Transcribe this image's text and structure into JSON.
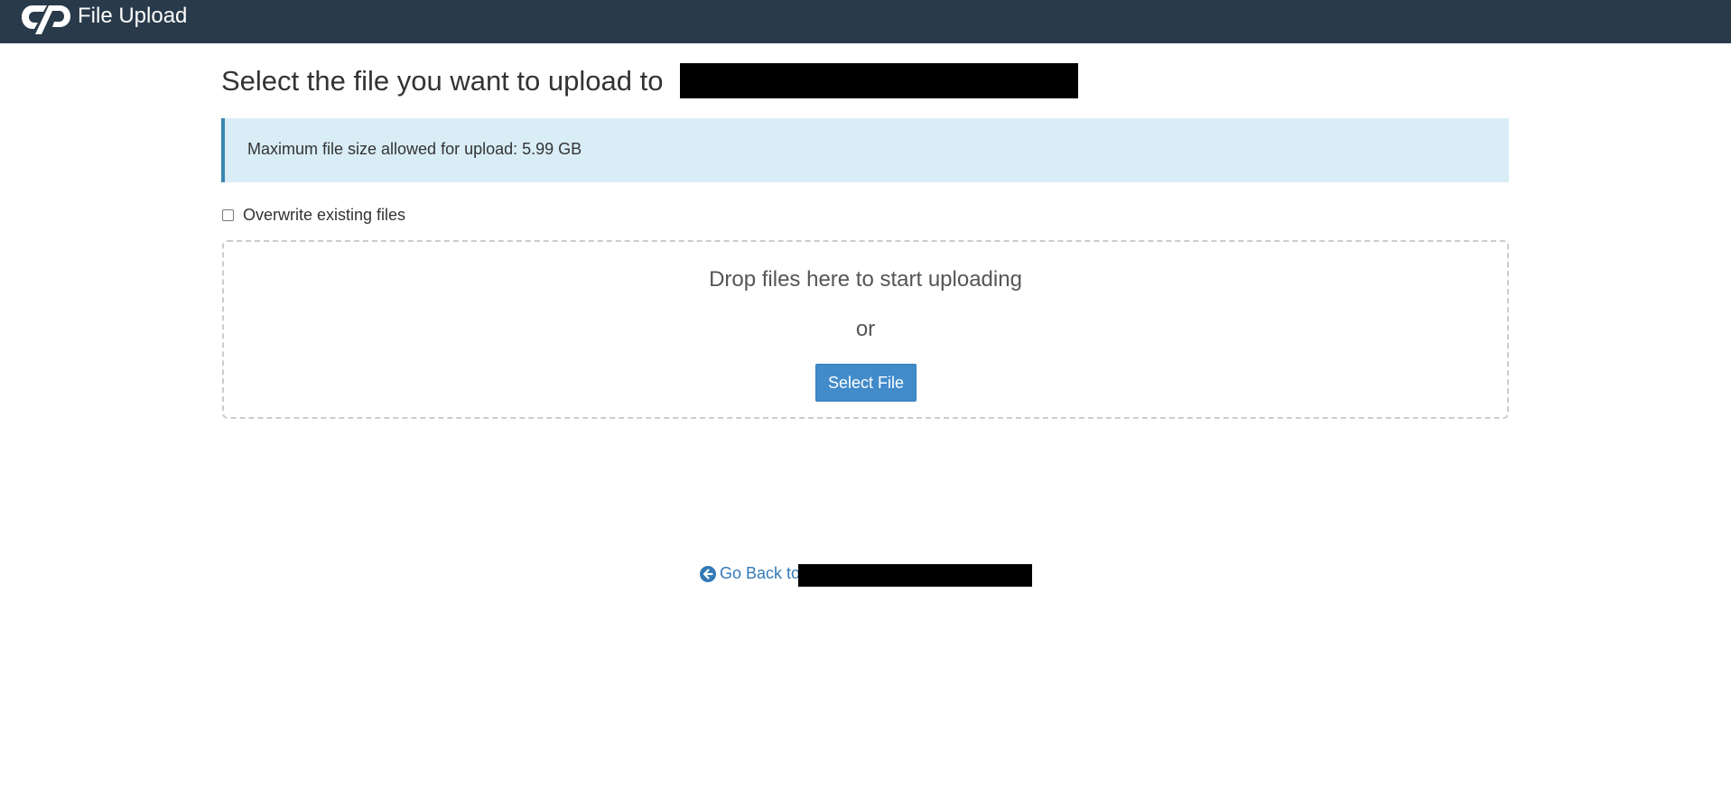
{
  "header": {
    "logo_icon": "cpanel-logo-icon",
    "app_title": "File Upload",
    "background_color": "#293a4a"
  },
  "main": {
    "title": "Select the file you want to upload to",
    "info": {
      "text": "Maximum file size allowed for upload: 5.99 GB",
      "background_color": "#d9edf7",
      "border_color": "#3a87ad"
    },
    "overwrite": {
      "label": "Overwrite existing files",
      "checked": false
    },
    "dropzone": {
      "drop_text": "Drop files here to start uploading",
      "or_text": "or",
      "select_button": "Select File",
      "button_color": "#428bca"
    }
  },
  "footer": {
    "go_back_icon": "arrow-circle-left-icon",
    "go_back_label": "Go Back to",
    "link_color": "#337ab7"
  }
}
